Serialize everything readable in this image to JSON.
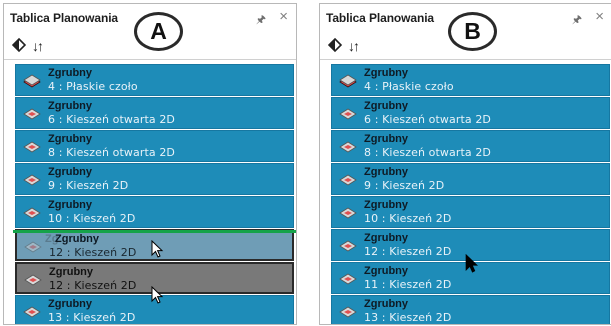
{
  "panels": [
    {
      "title": "Tablica Planowania",
      "badge": "A",
      "pin_icon": "pin-icon",
      "close_label": "×",
      "toolbar": {
        "sort_label": "↓↑"
      },
      "items": [
        {
          "type": "Zgrubny",
          "desc": "4 : Płaskie czoło"
        },
        {
          "type": "Zgrubny",
          "desc": "6 : Kieszeń otwarta 2D"
        },
        {
          "type": "Zgrubny",
          "desc": "8 : Kieszeń otwarta 2D"
        },
        {
          "type": "Zgrubny",
          "desc": "9 : Kieszeń 2D"
        },
        {
          "type": "Zgrubny",
          "desc": "10 : Kieszeń 2D"
        },
        {
          "type": "Zgrubny",
          "desc": "12 : Kieszeń 2D",
          "state": "ghost",
          "ghost_text": "Zg"
        },
        {
          "type": "Zgrubny",
          "desc": "12 : Kieszeń 2D",
          "state": "selected"
        },
        {
          "type": "Zgrubny",
          "desc": "13 : Kieszeń 2D"
        }
      ]
    },
    {
      "title": "Tablica Planowania",
      "badge": "B",
      "pin_icon": "pin-icon",
      "close_label": "×",
      "toolbar": {
        "sort_label": "↓↑"
      },
      "items": [
        {
          "type": "Zgrubny",
          "desc": "4 : Płaskie czoło"
        },
        {
          "type": "Zgrubny",
          "desc": "6 : Kieszeń otwarta 2D"
        },
        {
          "type": "Zgrubny",
          "desc": "8 : Kieszeń otwarta 2D"
        },
        {
          "type": "Zgrubny",
          "desc": "9 : Kieszeń 2D"
        },
        {
          "type": "Zgrubny",
          "desc": "10 : Kieszeń 2D"
        },
        {
          "type": "Zgrubny",
          "desc": "12 : Kieszeń 2D"
        },
        {
          "type": "Zgrubny",
          "desc": "11 : Kieszeń 2D"
        },
        {
          "type": "Zgrubny",
          "desc": "13 : Kieszeń 2D"
        }
      ]
    }
  ],
  "colors": {
    "item_bg": "#1e8cb8",
    "selected_bg": "#797979",
    "insert_line": "#15a34a"
  }
}
